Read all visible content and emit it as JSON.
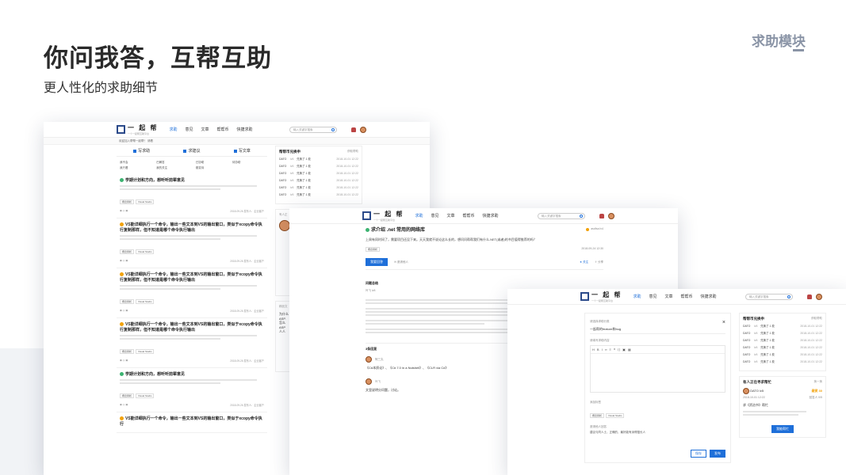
{
  "slide": {
    "title": "你问我答，互帮互助",
    "subtitle": "更人性化的求助细节",
    "tag": "求助模块"
  },
  "site": {
    "logo": "一 起 帮",
    "logo_sub": "一个一起帮互助平台",
    "nav": [
      "求助",
      "意见",
      "文章",
      "帮帮币",
      "快捷求助"
    ],
    "search_placeholder": "输入关键字搜索"
  },
  "shotA": {
    "crumb": "欢迎加入帮帮一起帮！ 请看",
    "tabs": [
      "写求助",
      "求建议",
      "写文章"
    ],
    "filters": [
      "我不会",
      "已解答",
      "已协助",
      "待协助",
      "我只看",
      "我的关注",
      "悬赏待"
    ],
    "questions": [
      {
        "title": "学期计划和方向，想听听前辈意见",
        "status": "green"
      },
      {
        "title": "VS能详细执行一个命令，输出一些文本到VS的输出窗口，类似于xcopy命令执行复制那样，但不知道是哪个命令执行输出",
        "status": "orange"
      },
      {
        "title": "VS能详细执行一个命令，输出一些文本到VS的输出窗口，类似于xcopy命令执行复制那样，但不知道是哪个命令执行输出",
        "status": "orange"
      },
      {
        "title": "VS能详细执行一个命令，输出一些文本到VS的输出窗口，类似于xcopy命令执行复制那样，但不知道是哪个命令执行输出",
        "status": "orange"
      },
      {
        "title": "学期计划和方向，想听听前辈意见",
        "status": "green"
      },
      {
        "title": "VS能详细执行一个命令，输出一些文本到VS的输出窗口，类似于xcopy命令执行",
        "status": "orange"
      }
    ],
    "chips": [
      "概念辨析",
      "Visual Studio"
    ],
    "meta_date": "2018-09-26",
    "meta_author": "发布人：企业客户",
    "side_title": "帮帮币兑换申",
    "side_more": "获取帮助",
    "rows": [
      {
        "name": "DATO",
        "lv": "lv5",
        "coin": "兑换了 1 枚",
        "date": "2018-10-01 12:22"
      },
      {
        "name": "DATO",
        "lv": "lv5",
        "coin": "兑换了 1 枚",
        "date": "2018-10-01 12:22"
      },
      {
        "name": "DATO",
        "lv": "lv5",
        "coin": "兑换了 1 枚",
        "date": "2018-10-01 12:22"
      },
      {
        "name": "DATO",
        "lv": "lv5",
        "coin": "兑换了 1 枚",
        "date": "2018-10-01 12:22"
      },
      {
        "name": "DATO",
        "lv": "lv5",
        "coin": "兑换了 1 枚",
        "date": "2018-10-01 12:22"
      },
      {
        "name": "DATO",
        "lv": "lv5",
        "coin": "兑换了 1 枚",
        "date": "2018-10-01 12:22"
      }
    ],
    "side2_title": "有人正",
    "side3_title": "精品文",
    "side3_items": [
      "为什么",
      "ASP.",
      "怎么",
      "ASP",
      "人人"
    ]
  },
  "shotB": {
    "title": "求介绍 .net 常用的网络库",
    "author": "asdfsa lv4",
    "desc": "上周有同时间了，需要项目还没下来。天天我就不说论这么长的，想问问帮帮我们有什么.NET(或者)的书目值得推荐的吗？",
    "chip": "概念辨析",
    "date": "2018-09-24 12:30",
    "btn_answer": "我要回答",
    "invite": "邀请他人",
    "collect": "关注",
    "share": "分享",
    "answers_title": "问题总结",
    "answer_user": "叶飞 lv5",
    "comments_title": "3条回复",
    "c1_user": "阿三丸",
    "c1_text": "《C#本质论》、《C# 7.0 in a Nutshell》、《CLR via C#》",
    "c2_user": "叶飞",
    "c2_text": "文里说明分问题，讨论。"
  },
  "shotC": {
    "modal_label1": "请选择求助分类",
    "modal_value1": "一起帮的feature和bug",
    "modal_label2": "请填写求助内容",
    "modal_label3": "添加标签",
    "modal_chips": [
      "概念辨析",
      "Visual Studio"
    ],
    "modal_label4": "邀请他人回答",
    "modal_note": "建议与同人士，正确的，最好能有深得擅长人",
    "btn_save": "保存",
    "btn_publish": "发布",
    "side_title": "帮帮币兑换申",
    "side_more": "获取帮助",
    "help_title": "有人正在寻求帮忙",
    "help_more": "换一换",
    "help_user": "DATO lv5",
    "help_reward": "悬赏 30",
    "help_date": "2018-10-01 12:22",
    "help_count": "回答人 0/5",
    "help_q": "求《资治书》帮忙",
    "help_btn": "我能帮忙"
  }
}
